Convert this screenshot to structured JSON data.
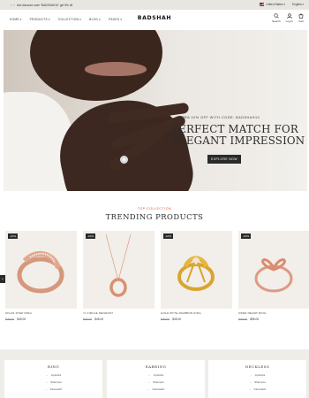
{
  "announcement": {
    "text": "Use discount code \"BADSHAH10\" get 5% off",
    "region": "United States",
    "language": "English"
  },
  "header": {
    "logo": "BADSHAH",
    "nav": [
      "HOME",
      "PRODUCTS",
      "COLLECTION",
      "BLOG",
      "PAGES"
    ],
    "icons": [
      {
        "icon": "search-icon",
        "label": "Search"
      },
      {
        "icon": "user-icon",
        "label": "Log In"
      },
      {
        "icon": "cart-icon",
        "label": "Cart"
      }
    ]
  },
  "hero": {
    "subtitle": "EXTRA 10% OFF WITH CODE: BADSHAH10",
    "title_line1": "PERFECT MATCH FOR",
    "title_line2": "ELEGANT IMPRESSION",
    "cta": "EXPLORE NOW"
  },
  "trending": {
    "eyebrow": "TOP COLLECTION",
    "title": "TRENDING PRODUCTS",
    "products": [
      {
        "badge": "-10%",
        "name": "ATLAS STEP RING",
        "old_price": "$49.00",
        "price": "$45.00"
      },
      {
        "badge": "-10%",
        "name": "YI CIRCLE PENDANT",
        "old_price": "$49.00",
        "price": "$45.00"
      },
      {
        "badge": "-10%",
        "name": "GOLD BYTE RIGBBON RING",
        "old_price": "$49.00",
        "price": "$45.00"
      },
      {
        "badge": "-10%",
        "name": "OPEN HEART RING",
        "old_price": "$49.00",
        "price": "$55.00"
      }
    ],
    "prev_arrow": "‹",
    "next_arrow": "›"
  },
  "categories": [
    {
      "title": "RING",
      "items": [
        "Lipsticks",
        "Shampoo",
        "Facewash"
      ]
    },
    {
      "title": "EARRING",
      "items": [
        "Lipsticks",
        "Shampoo",
        "Facewash"
      ]
    },
    {
      "title": "NECKLESS",
      "items": [
        "Lipsticks",
        "Shampoo",
        "Facewash"
      ]
    }
  ],
  "colors": {
    "accent": "#e0582b",
    "dark": "#2a2a2a",
    "panel_bg": "#eeede8",
    "product_bg": "#f2eee9"
  }
}
